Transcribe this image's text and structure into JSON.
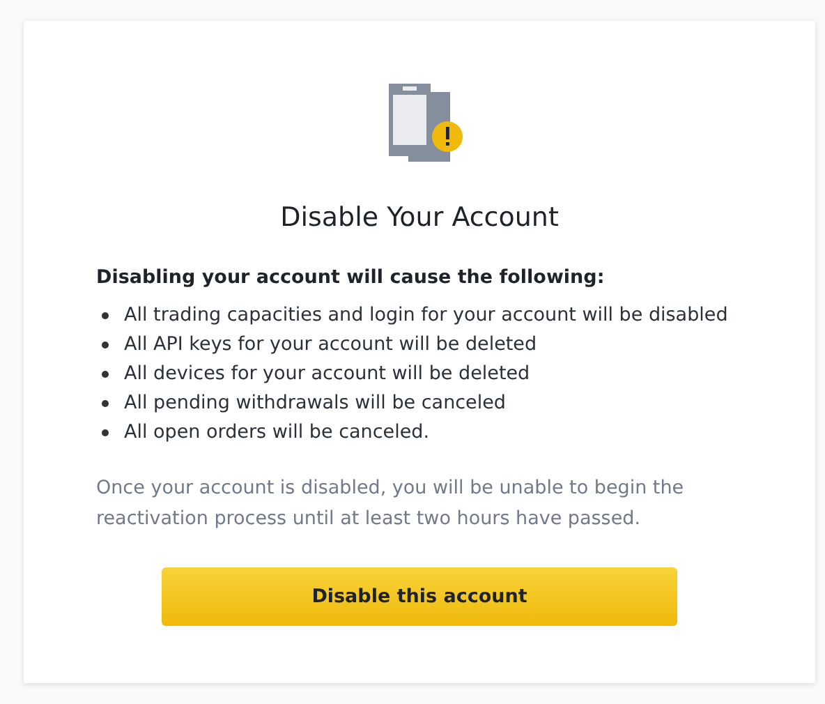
{
  "title": "Disable Your Account",
  "subheading": "Disabling your account will cause the following:",
  "consequences": [
    "All trading capacities and login for your account will be disabled",
    "All API keys for your account will be deleted",
    "All devices for your account will be deleted",
    "All pending withdrawals will be canceled",
    "All open orders will be canceled."
  ],
  "note": "Once your account is disabled, you will be unable to begin the reactivation process until at least two hours have passed.",
  "button": "Disable this account"
}
